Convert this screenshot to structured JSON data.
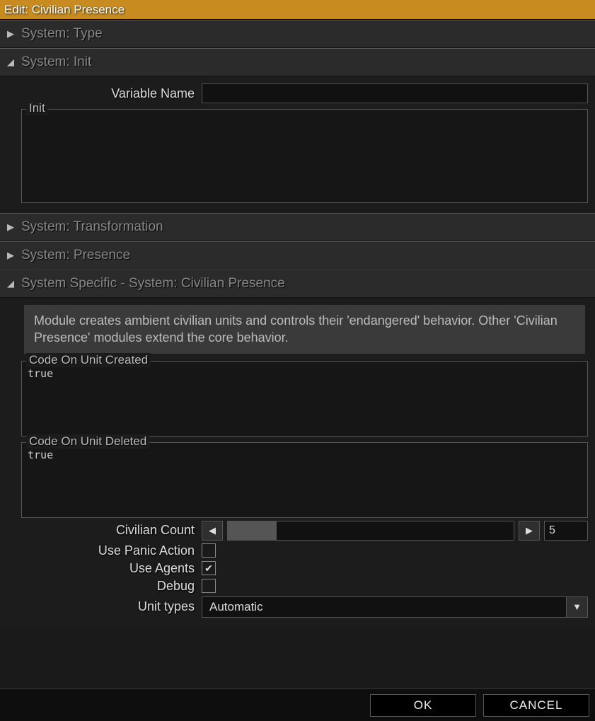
{
  "title": "Edit: Civilian Presence",
  "sections": {
    "type": {
      "label": "System: Type",
      "expanded": false
    },
    "init": {
      "label": "System: Init",
      "expanded": true,
      "variable_name_label": "Variable Name",
      "variable_name_value": "",
      "init_group_label": "Init",
      "init_value": ""
    },
    "transformation": {
      "label": "System: Transformation",
      "expanded": false
    },
    "presence": {
      "label": "System: Presence",
      "expanded": false
    },
    "specific": {
      "label": "System Specific - System: Civilian Presence",
      "expanded": true,
      "description": "Module creates ambient civilian units and controls their 'endangered' behavior. Other 'Civilian Presence' modules extend the core behavior.",
      "code_created_label": "Code On Unit Created",
      "code_created_value": "true",
      "code_deleted_label": "Code On Unit Deleted",
      "code_deleted_value": "true",
      "civilian_count_label": "Civilian Count",
      "civilian_count_value": "5",
      "civilian_count_fill_percent": 17,
      "use_panic_label": "Use Panic Action",
      "use_panic_checked": false,
      "use_agents_label": "Use Agents",
      "use_agents_checked": true,
      "debug_label": "Debug",
      "debug_checked": false,
      "unit_types_label": "Unit types",
      "unit_types_value": "Automatic"
    }
  },
  "buttons": {
    "ok": "OK",
    "cancel": "CANCEL"
  },
  "glyphs": {
    "check": "✔"
  }
}
